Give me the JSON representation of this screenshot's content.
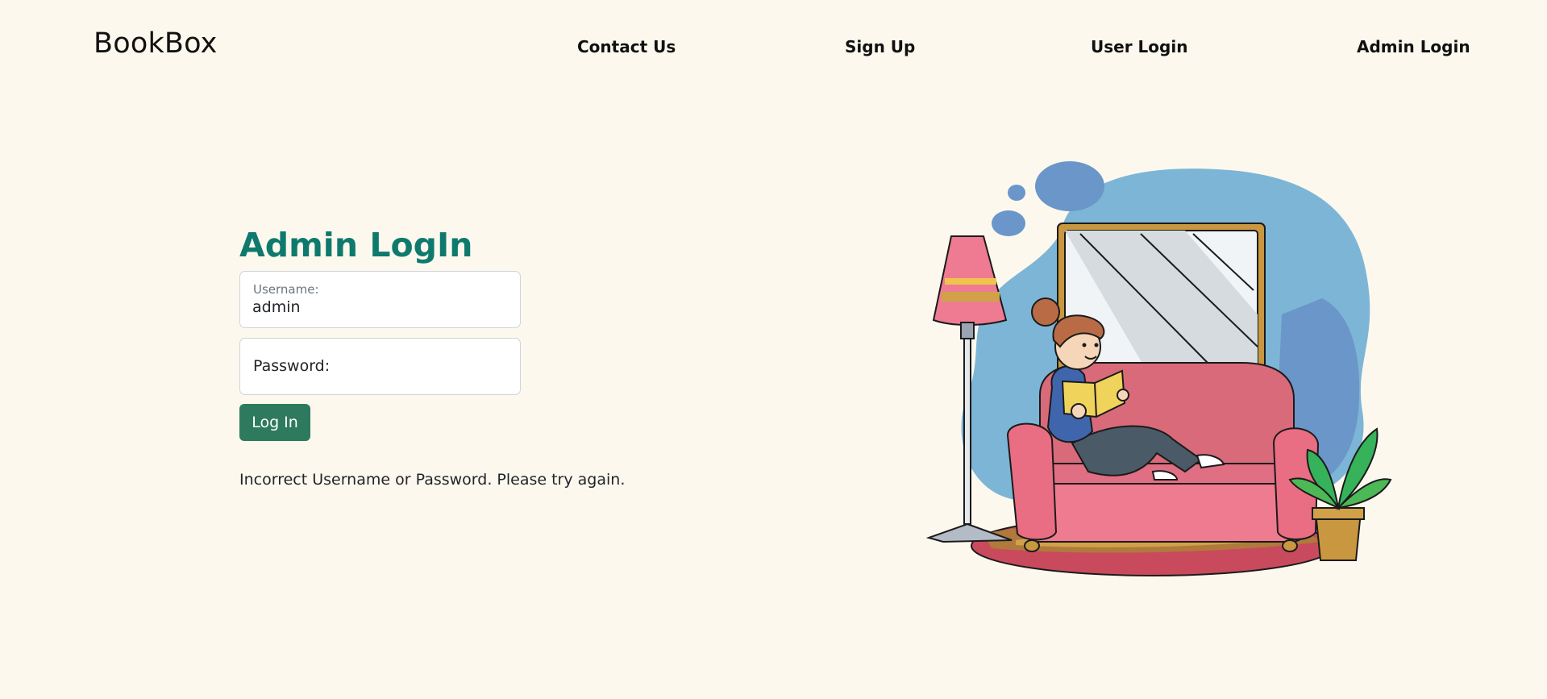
{
  "navbar": {
    "brand": "BookBox",
    "links": [
      {
        "label": "Contact Us"
      },
      {
        "label": "Sign Up"
      },
      {
        "label": "User Login"
      },
      {
        "label": "Admin Login"
      }
    ]
  },
  "login": {
    "title": "Admin LogIn",
    "username": {
      "label": "Username:",
      "value": "admin"
    },
    "password": {
      "label": "Password:"
    },
    "submit_label": "Log In",
    "error_message": "Incorrect Username or Password. Please try again."
  },
  "illustration": {
    "subject": "person-reading-on-sofa-illustration"
  },
  "colors": {
    "background": "#fdf8ee",
    "title": "#0e7a6d",
    "button": "#2e7a5e",
    "text": "#212529"
  }
}
